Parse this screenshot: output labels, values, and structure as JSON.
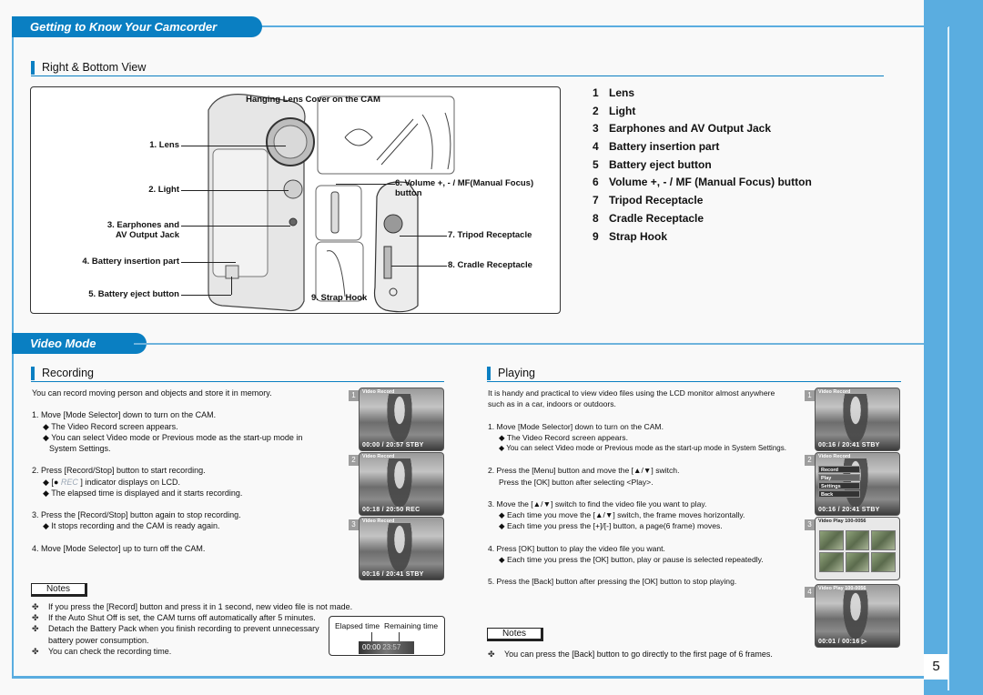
{
  "page": {
    "number": "5",
    "colors": {
      "accent": "#0a7fc2",
      "band": "#5aade0"
    }
  },
  "section1": {
    "title": "Getting to Know Your Camcorder",
    "subheading": "Right & Bottom View",
    "diagram": {
      "inset_title": "Hanging Lens Cover on the CAM",
      "callouts": {
        "lens": "1. Lens",
        "light": "2. Light",
        "earphones_1": "3. Earphones and",
        "earphones_2": "AV Output Jack",
        "battery_insertion": "4. Battery insertion part",
        "battery_eject": "5. Battery eject button",
        "volume": "6. Volume +, - / MF(Manual Focus) button",
        "tripod": "7. Tripod Receptacle",
        "cradle": "8. Cradle Receptacle",
        "strap": "9. Strap Hook"
      }
    },
    "parts": [
      {
        "num": "1",
        "label": "Lens"
      },
      {
        "num": "2",
        "label": "Light"
      },
      {
        "num": "3",
        "label": "Earphones and AV Output Jack"
      },
      {
        "num": "4",
        "label": "Battery insertion part"
      },
      {
        "num": "5",
        "label": "Battery eject button"
      },
      {
        "num": "6",
        "label": "Volume +, - / MF (Manual Focus) button"
      },
      {
        "num": "7",
        "label": "Tripod Receptacle"
      },
      {
        "num": "8",
        "label": "Cradle Receptacle"
      },
      {
        "num": "9",
        "label": "Strap Hook"
      }
    ]
  },
  "section2": {
    "title": "Video Mode",
    "recording": {
      "heading": "Recording",
      "intro": "You can record moving person and objects and store it in memory.",
      "step1": "1. Move [Mode Selector] down to turn on the CAM.",
      "step1_b1": "◆ The Video Record screen appears.",
      "step1_b2a": "◆ You can select Video mode or Previous mode as the start-up mode in",
      "step1_b2b": "System Settings.",
      "step2": "2. Press [Record/Stop] button to start recording.",
      "step2_b1_pre": "◆ [",
      "step2_b1_dot": "●",
      "step2_b1_rec": "REC",
      "step2_b1_post": "] indicator displays on LCD.",
      "step2_b2": "◆ The elapsed time is displayed and it starts recording.",
      "step3": "3. Press the [Record/Stop] button again to stop recording.",
      "step3_b1": "◆ It stops recording and the CAM is ready again.",
      "step4": "4. Move [Mode Selector] up to turn off the CAM.",
      "notes_label": "Notes",
      "notes": [
        "If you press the [Record] button and press it in 1 second, new video file is not made.",
        "If the Auto Shut Off is set, the CAM turns off automatically after 5 minutes.",
        "Detach the Battery Pack when you finish recording to prevent unnecessary",
        "You can check the recording time."
      ],
      "note3_cont": "battery power consumption.",
      "note_bullet": "✤",
      "elapsed": {
        "elapsed_label": "Elapsed time",
        "remaining_label": "Remaining time",
        "elapsed_value": "00:00",
        "remaining_value": "23:57"
      },
      "screens": [
        {
          "step": "1",
          "top": "Video Record",
          "bottom": "00:00 / 20:57 STBY"
        },
        {
          "step": "2",
          "top": "Video Record",
          "bottom": "00:18 / 20:50 REC"
        },
        {
          "step": "3",
          "top": "Video Record",
          "bottom": "00:16 / 20:41 STBY"
        }
      ]
    },
    "playing": {
      "heading": "Playing",
      "intro1": "It is handy and practical to view video files using the LCD monitor almost anywhere",
      "intro2": "such as in a car, indoors or outdoors.",
      "step1": "1. Move [Mode Selector] down to turn on the CAM.",
      "step1_b1": "◆ The Video Record screen appears.",
      "step1_b2": "◆ You can select Video mode or Previous mode as the start-up mode in System Settings.",
      "step2a": "2. Press the [Menu] button and move the [▲/▼] switch.",
      "step2b": "Press the [OK] button after selecting <Play>.",
      "step3": "3. Move the [▲/▼] switch to find the video file you want to play.",
      "step3_b1": "◆ Each time you move the [▲/▼] switch, the frame moves horizontally.",
      "step3_b2": "◆ Each time you press the [+]/[-] button, a page(6 frame) moves.",
      "step4": "4. Press [OK] button to play the video file you want.",
      "step4_b1": "◆ Each time you press the [OK] button, play or pause is selected repeatedly.",
      "step5": "5. Press the [Back] button after pressing the [OK] button to stop playing.",
      "notes_label": "Notes",
      "note": "You can press the [Back] button to go directly to the first page of 6 frames.",
      "note_bullet": "✤",
      "screens": [
        {
          "step": "1",
          "top": "Video Record",
          "bottom": "00:16 / 20:41 STBY"
        },
        {
          "step": "2",
          "top": "Video Record",
          "bottom": "00:16 / 20:41 STBY",
          "menu": [
            "Record",
            "Play",
            "Settings",
            "Back"
          ]
        },
        {
          "step": "3",
          "top": "Video Play   100-0056"
        },
        {
          "step": "4",
          "top": "Video Play   100-0056",
          "bottom": "00:01 / 00:16 ▷"
        }
      ]
    }
  }
}
